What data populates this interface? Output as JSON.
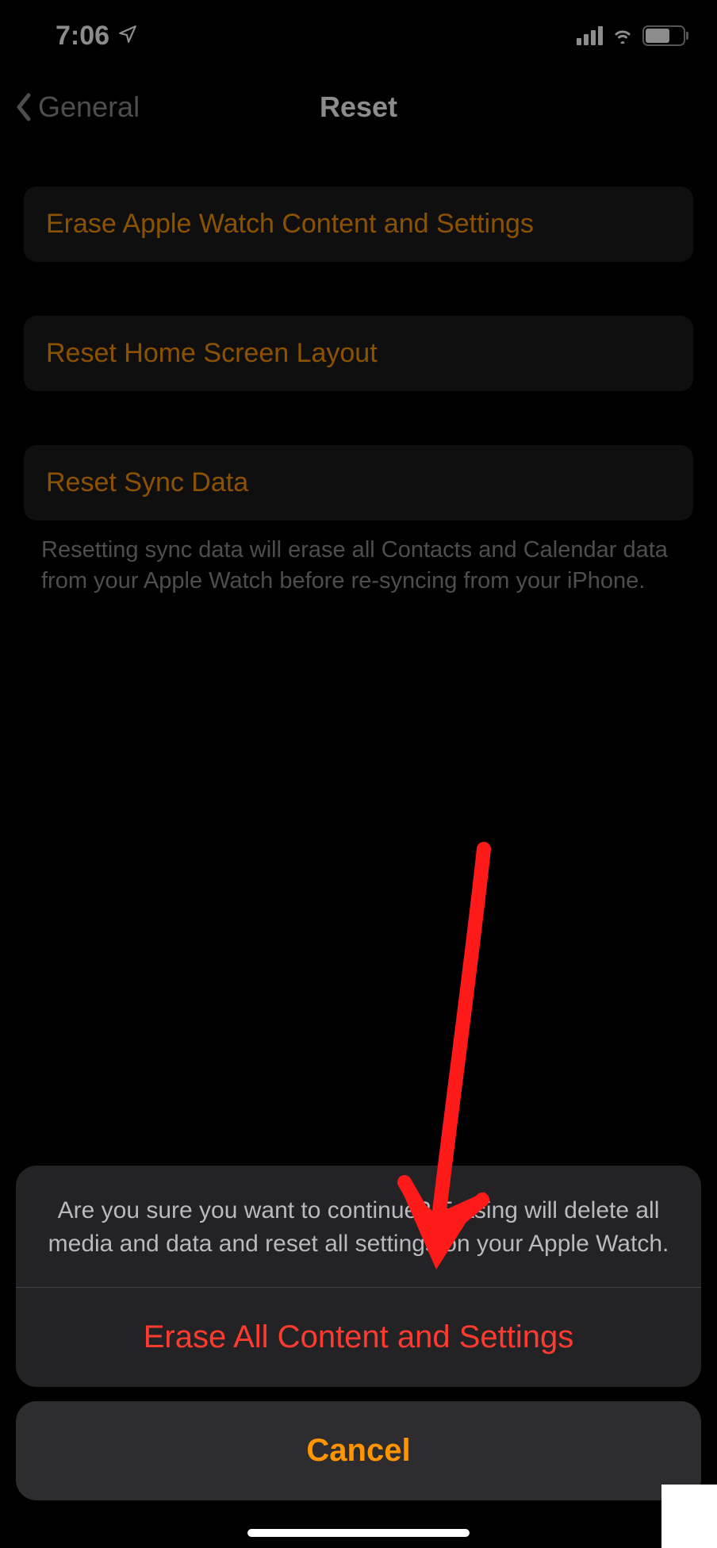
{
  "status": {
    "time": "7:06",
    "location_icon": "location-arrow",
    "signal": 4,
    "wifi": "wifi-icon",
    "battery_icon": "battery-icon"
  },
  "nav": {
    "back_label": "General",
    "title": "Reset"
  },
  "cells": {
    "erase": "Erase Apple Watch Content and Settings",
    "reset_home": "Reset Home Screen Layout",
    "reset_sync": "Reset Sync Data",
    "reset_sync_footer": "Resetting sync data will erase all Contacts and Calendar data from your Apple Watch before re-syncing from your iPhone."
  },
  "sheet": {
    "message": "Are you sure you want to continue? Erasing will delete all media and data and reset all settings on your Apple Watch.",
    "destructive": "Erase All Content and Settings",
    "cancel": "Cancel"
  },
  "annotation": {
    "arrow_color": "#ff1a1a"
  }
}
